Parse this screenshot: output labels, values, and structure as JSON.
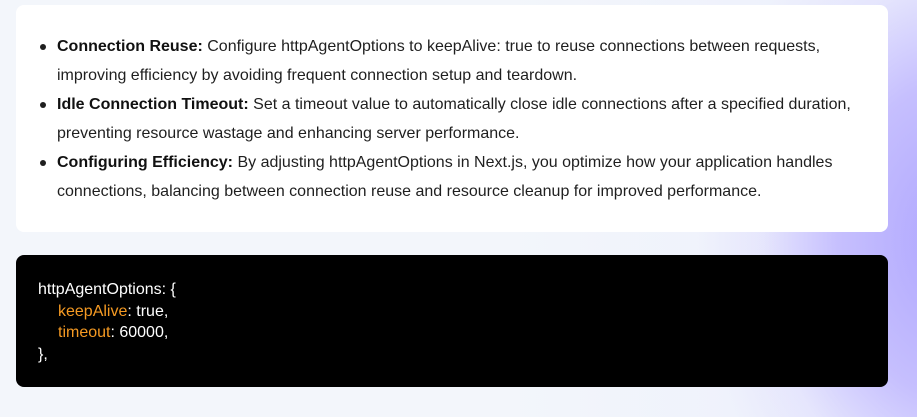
{
  "bullets": [
    {
      "title": "Connection Reuse:",
      "text": " Configure httpAgentOptions to keepAlive: true to reuse connections between requests, improving efficiency by avoiding frequent connection setup and teardown."
    },
    {
      "title": "Idle Connection Timeout:",
      "text": " Set a timeout value to automatically close idle connections after a specified duration, preventing resource wastage and enhancing server performance."
    },
    {
      "title": "Configuring Efficiency:",
      "text": " By adjusting httpAgentOptions in Next.js, you optimize how your application handles connections, balancing between connection reuse and resource cleanup for improved performance."
    }
  ],
  "code": {
    "line1": "httpAgentOptions: {",
    "line2_key": "keepAlive",
    "line2_rest": ": true,",
    "line3_key": "timeout",
    "line3_rest": ": 60000,",
    "line4": "},"
  },
  "colors": {
    "code_key": "#f59a23",
    "code_bg": "#000000",
    "glow": "#aaa0ff"
  }
}
